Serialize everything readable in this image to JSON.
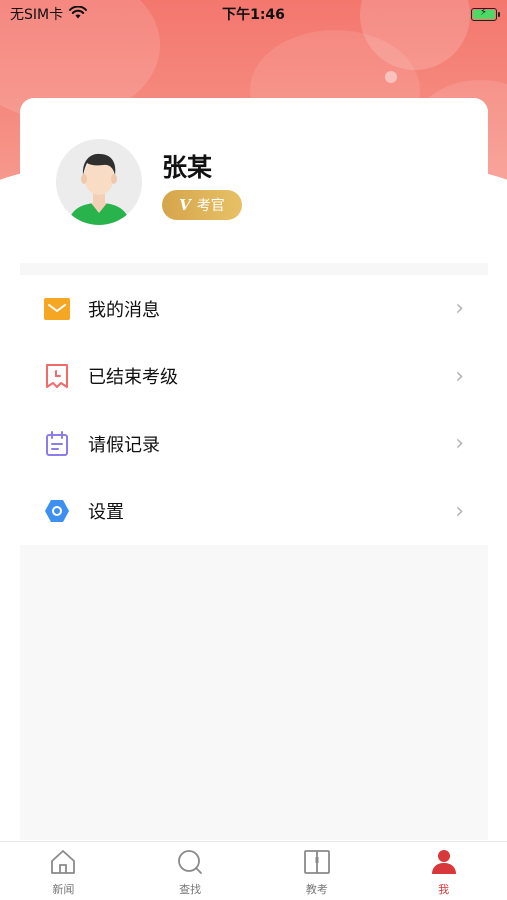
{
  "status_bar": {
    "carrier": "无SIM卡",
    "time": "下午1:46",
    "battery_state": "charging"
  },
  "profile": {
    "name": "张某",
    "badge_icon": "V",
    "badge_label": "考官"
  },
  "menu": {
    "items": [
      {
        "label": "我的消息",
        "icon": "mail-icon",
        "color": "#f5a623"
      },
      {
        "label": "已结束考级",
        "icon": "ticket-clock-icon",
        "color": "#f26b6b"
      },
      {
        "label": "请假记录",
        "icon": "calendar-note-icon",
        "color": "#8b7ee8"
      },
      {
        "label": "设置",
        "icon": "gear-hexagon-icon",
        "color": "#3d8ff0"
      }
    ]
  },
  "tabbar": {
    "tabs": [
      {
        "label": "新闻",
        "icon": "home-icon"
      },
      {
        "label": "查找",
        "icon": "search-icon"
      },
      {
        "label": "教考",
        "icon": "book-icon"
      },
      {
        "label": "我",
        "icon": "user-icon",
        "active": true
      }
    ]
  },
  "colors": {
    "header": "#f4776e",
    "accent": "#d8383a",
    "badge": "#e0b25a"
  }
}
